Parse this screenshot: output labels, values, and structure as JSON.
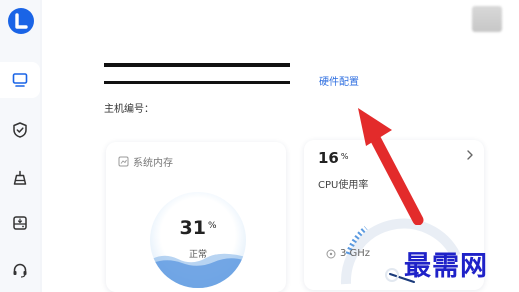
{
  "main": {
    "hardware_link": "硬件配置",
    "host_id_label": "主机编号："
  },
  "memory_card": {
    "title": "系统内存",
    "value": "31",
    "unit": "%",
    "status": "正常",
    "level": 0.31
  },
  "cpu_card": {
    "value": "16",
    "unit": "%",
    "label": "CPU使用率",
    "frequency": "3 GHz",
    "level": 0.16
  },
  "watermark": "最需网",
  "colors": {
    "accent": "#2f6fe0",
    "arrow": "#e32b2b",
    "watermark": "#1f22c8"
  },
  "sidebar": {
    "items": [
      {
        "icon": "monitor-icon"
      },
      {
        "icon": "shield-check-icon"
      },
      {
        "icon": "broom-icon"
      },
      {
        "icon": "disk-icon"
      },
      {
        "icon": "headset-icon"
      }
    ]
  }
}
